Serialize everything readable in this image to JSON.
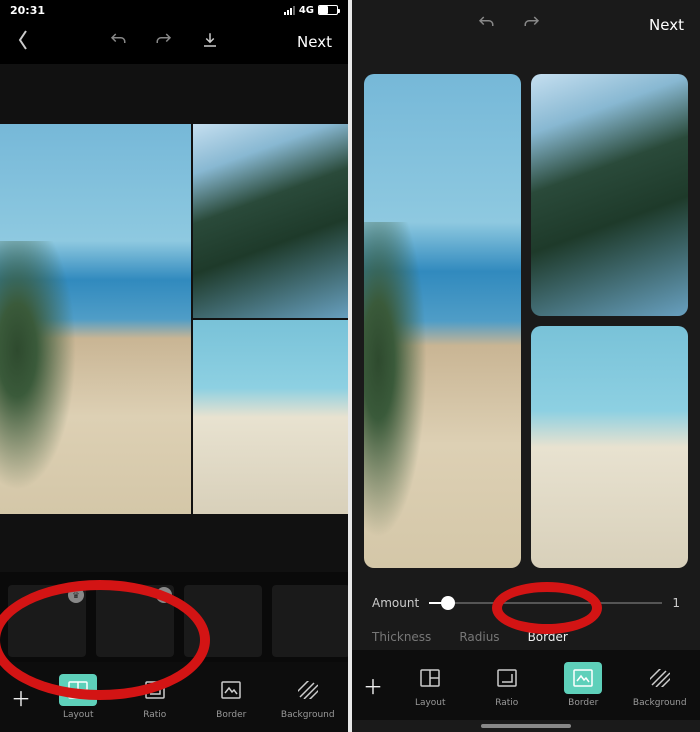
{
  "statusBar": {
    "time": "20:31",
    "network": "4G"
  },
  "nav": {
    "next": "Next"
  },
  "toolbar": {
    "items": [
      {
        "label": "Layout",
        "active": true,
        "icon": "layout-icon"
      },
      {
        "label": "Ratio",
        "active": false,
        "icon": "ratio-icon"
      },
      {
        "label": "Border",
        "active": false,
        "icon": "border-icon"
      },
      {
        "label": "Background",
        "active": false,
        "icon": "background-icon"
      }
    ]
  },
  "rightPanel": {
    "amountLabel": "Amount",
    "amountValue": "1",
    "tabs": [
      {
        "label": "Thickness",
        "active": false
      },
      {
        "label": "Radius",
        "active": false
      },
      {
        "label": "Border",
        "active": true
      }
    ],
    "toolbar": [
      {
        "label": "Layout",
        "active": false,
        "icon": "layout-icon"
      },
      {
        "label": "Ratio",
        "active": false,
        "icon": "ratio-icon"
      },
      {
        "label": "Border",
        "active": true,
        "icon": "border-icon"
      },
      {
        "label": "Background",
        "active": false,
        "icon": "background-icon"
      }
    ]
  },
  "templates": {
    "premiumBadge": "♛"
  }
}
